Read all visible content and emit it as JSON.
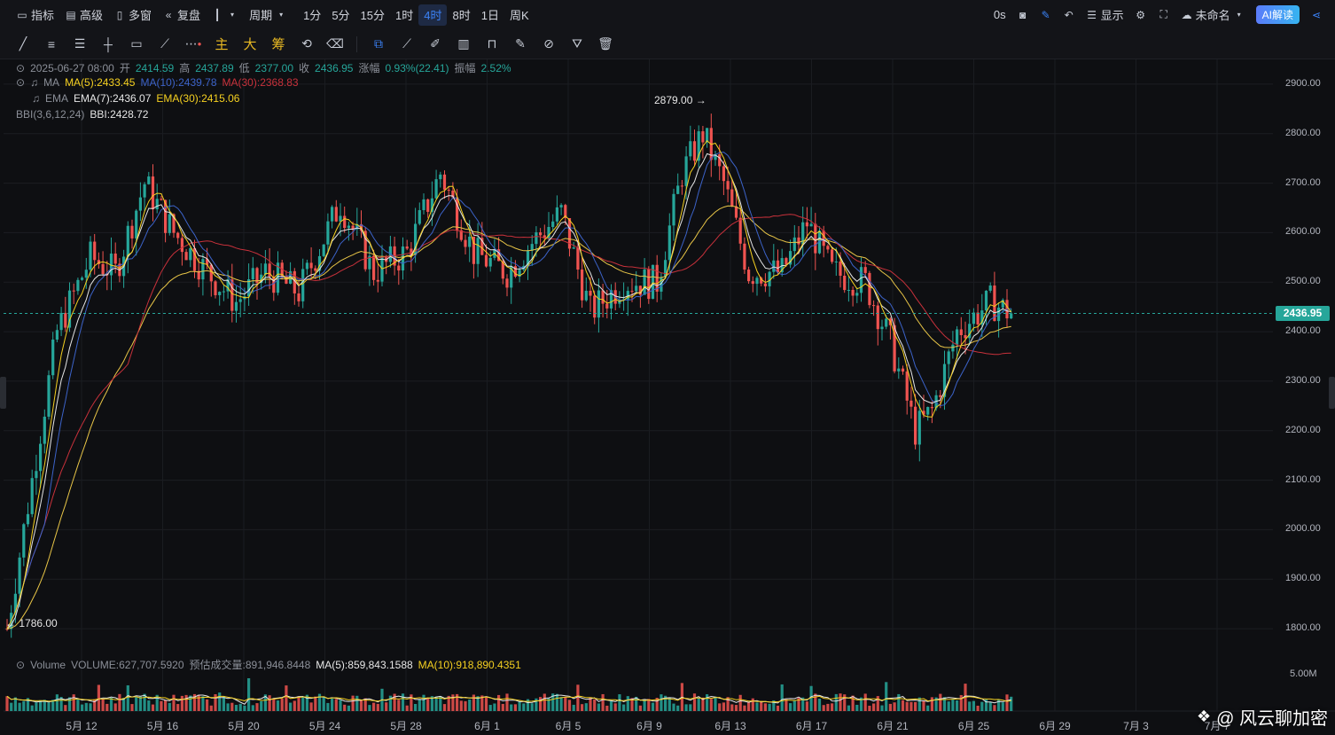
{
  "topbar": {
    "left": [
      {
        "icon": "chart-icon",
        "label": "指标"
      },
      {
        "icon": "calendar-icon",
        "label": "高级"
      },
      {
        "icon": "grid-icon",
        "label": "多窗"
      },
      {
        "icon": "rewind-icon",
        "label": "复盘"
      },
      {
        "icon": "candle-type-icon",
        "label": ""
      },
      {
        "icon": "",
        "label": "周期"
      }
    ],
    "intervals": [
      "1分",
      "5分",
      "15分",
      "1时",
      "4时",
      "8时",
      "1日",
      "周K"
    ],
    "active_interval": "4时",
    "right": {
      "countdown": "0s",
      "display_label": "显示",
      "layout_name": "未命名",
      "ai_label": "AI解读"
    }
  },
  "toolbar": {
    "mode_labels": [
      "主",
      "大",
      "筹"
    ]
  },
  "legend": {
    "date": "2025-06-27 08:00",
    "open_label": "开",
    "open": "2414.59",
    "high_label": "高",
    "high": "2437.89",
    "low_label": "低",
    "low": "2377.00",
    "close_label": "收",
    "close": "2436.95",
    "change_label": "涨幅",
    "change": "0.93%(22.41)",
    "amp_label": "振幅",
    "amp": "2.52%",
    "ma_label": "MA",
    "ma5": "MA(5):2433.45",
    "ma10": "MA(10):2439.78",
    "ma30": "MA(30):2368.83",
    "ema_label": "EMA",
    "ema7": "EMA(7):2436.07",
    "ema30": "EMA(30):2415.06",
    "bbi_label": "BBI(3,6,12,24)",
    "bbi": "BBI:2428.72"
  },
  "volume_legend": {
    "label": "Volume",
    "volume": "VOLUME:627,707.5920",
    "est": "预估成交量:891,946.8448",
    "ma5": "MA(5):859,843.1588",
    "ma10": "MA(10):918,890.4351"
  },
  "price_axis": [
    "2900.00",
    "2800.00",
    "2700.00",
    "2600.00",
    "2500.00",
    "2400.00",
    "2300.00",
    "2200.00",
    "2100.00",
    "2000.00",
    "1900.00",
    "1800.00"
  ],
  "current_price": "2436.95",
  "volume_axis_label": "5.00M",
  "date_axis": [
    "5月 12",
    "5月 16",
    "5月 20",
    "5月 24",
    "5月 28",
    "6月 1",
    "6月 5",
    "6月 9",
    "6月 13",
    "6月 17",
    "6月 21",
    "6月 25",
    "6月 29",
    "7月 3",
    "7月 7"
  ],
  "annotations": {
    "high": "2879.00",
    "low": "1786.00"
  },
  "colors": {
    "up": "#26a69a",
    "down": "#ef5350",
    "ma5": "#f5d020",
    "ma10": "#3c63c9",
    "ma30": "#c8313b",
    "ema7": "#e6e6e6",
    "ema30": "#e8c547"
  },
  "watermark": "@ 风云聊加密",
  "chart_data": {
    "type": "candlestick",
    "interval": "4h",
    "price_range": [
      1750,
      2950
    ],
    "anchors": [
      {
        "t": 0,
        "p": 1800
      },
      {
        "t": 6,
        "p": 2100
      },
      {
        "t": 12,
        "p": 2400
      },
      {
        "t": 20,
        "p": 2550
      },
      {
        "t": 26,
        "p": 2520
      },
      {
        "t": 33,
        "p": 2700
      },
      {
        "t": 40,
        "p": 2600
      },
      {
        "t": 48,
        "p": 2520
      },
      {
        "t": 55,
        "p": 2460
      },
      {
        "t": 62,
        "p": 2520
      },
      {
        "t": 70,
        "p": 2480
      },
      {
        "t": 80,
        "p": 2660
      },
      {
        "t": 88,
        "p": 2520
      },
      {
        "t": 96,
        "p": 2560
      },
      {
        "t": 104,
        "p": 2720
      },
      {
        "t": 112,
        "p": 2560
      },
      {
        "t": 120,
        "p": 2520
      },
      {
        "t": 126,
        "p": 2580
      },
      {
        "t": 133,
        "p": 2640
      },
      {
        "t": 140,
        "p": 2440
      },
      {
        "t": 148,
        "p": 2500
      },
      {
        "t": 156,
        "p": 2500
      },
      {
        "t": 162,
        "p": 2720
      },
      {
        "t": 167,
        "p": 2800
      },
      {
        "t": 172,
        "p": 2700
      },
      {
        "t": 178,
        "p": 2520
      },
      {
        "t": 186,
        "p": 2520
      },
      {
        "t": 192,
        "p": 2620
      },
      {
        "t": 198,
        "p": 2520
      },
      {
        "t": 206,
        "p": 2500
      },
      {
        "t": 212,
        "p": 2380
      },
      {
        "t": 218,
        "p": 2200
      },
      {
        "t": 222,
        "p": 2240
      },
      {
        "t": 228,
        "p": 2400
      },
      {
        "t": 236,
        "p": 2460
      },
      {
        "t": 241,
        "p": 2437
      }
    ]
  }
}
